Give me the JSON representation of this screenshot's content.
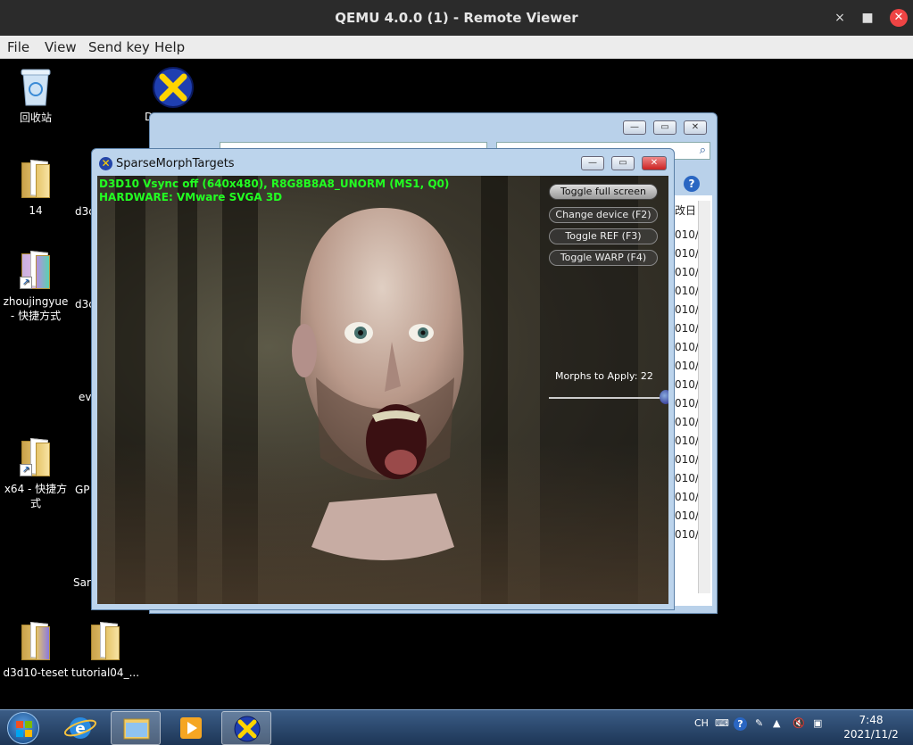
{
  "qemu": {
    "title": "QEMU 4.0.0 (1) - Remote Viewer",
    "controls": {
      "minimize": "×",
      "maximize": "■",
      "close": "✕"
    },
    "menu": [
      "File",
      "View",
      "Send key",
      "Help"
    ]
  },
  "desktop": {
    "icons": [
      {
        "label": "回收站",
        "icon": "recycle-bin-icon"
      },
      {
        "label": "14",
        "icon": "folder-icon"
      },
      {
        "label": "zhoujingyue\n- 快捷方式",
        "icon": "shortcut-folder-icon"
      },
      {
        "label": "x64 - 快捷方\n式",
        "icon": "shortcut-folder-icon"
      },
      {
        "label": "d3d10-teset",
        "icon": "folder-icon"
      },
      {
        "label": "tutorial04_...",
        "icon": "folder-icon"
      }
    ],
    "partial_labels": [
      "D",
      "d3c",
      "d3c",
      "ev",
      "GP",
      "Sar"
    ]
  },
  "explorer": {
    "list_items": [
      "改日",
      "010/",
      "010/",
      "010/",
      "010/",
      "010/",
      "010/",
      "010/",
      "010/",
      "010/",
      "010/",
      "010/",
      "010/",
      "010/",
      "010/",
      "010/",
      "010/",
      "010/"
    ]
  },
  "d3d": {
    "title": "SparseMorphTargets",
    "hud_line1": "D3D10 Vsync off (640x480), R8G8B8A8_UNORM (MS1, Q0)",
    "hud_line2": "HARDWARE: VMware SVGA 3D",
    "buttons": {
      "fullscreen": "Toggle full screen",
      "device": "Change device (F2)",
      "ref": "Toggle REF (F3)",
      "warp": "Toggle WARP (F4)"
    },
    "morphs_label": "Morphs to Apply: 22",
    "morphs_value": 22
  },
  "taskbar": {
    "tray_lang": "CH",
    "time": "7:48",
    "date": "2021/11/2"
  },
  "colors": {
    "hud_green": "#22ff22",
    "title_bar": "#2b2b2b"
  }
}
